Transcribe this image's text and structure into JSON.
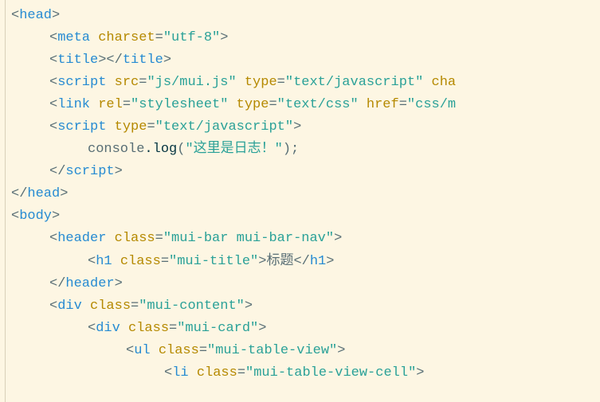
{
  "lines": [
    {
      "indent": 1,
      "segments": [
        {
          "cls": "punct",
          "t": "<"
        },
        {
          "cls": "tag",
          "t": "head"
        },
        {
          "cls": "punct",
          "t": ">"
        }
      ]
    },
    {
      "indent": 2,
      "segments": [
        {
          "cls": "punct",
          "t": "<"
        },
        {
          "cls": "tag",
          "t": "meta "
        },
        {
          "cls": "attr",
          "t": "charset"
        },
        {
          "cls": "equals",
          "t": "="
        },
        {
          "cls": "string",
          "t": "\"utf-8\""
        },
        {
          "cls": "punct",
          "t": ">"
        }
      ]
    },
    {
      "indent": 2,
      "segments": [
        {
          "cls": "punct",
          "t": "<"
        },
        {
          "cls": "tag",
          "t": "title"
        },
        {
          "cls": "punct",
          "t": "></"
        },
        {
          "cls": "tag",
          "t": "title"
        },
        {
          "cls": "punct",
          "t": ">"
        }
      ]
    },
    {
      "indent": 2,
      "segments": [
        {
          "cls": "punct",
          "t": "<"
        },
        {
          "cls": "tag",
          "t": "script "
        },
        {
          "cls": "attr",
          "t": "src"
        },
        {
          "cls": "equals",
          "t": "="
        },
        {
          "cls": "string",
          "t": "\"js/mui.js\""
        },
        {
          "cls": "tag",
          "t": " "
        },
        {
          "cls": "attr",
          "t": "type"
        },
        {
          "cls": "equals",
          "t": "="
        },
        {
          "cls": "string",
          "t": "\"text/javascript\""
        },
        {
          "cls": "tag",
          "t": " "
        },
        {
          "cls": "attr",
          "t": "cha"
        }
      ]
    },
    {
      "indent": 2,
      "segments": [
        {
          "cls": "punct",
          "t": "<"
        },
        {
          "cls": "tag",
          "t": "link "
        },
        {
          "cls": "attr",
          "t": "rel"
        },
        {
          "cls": "equals",
          "t": "="
        },
        {
          "cls": "string",
          "t": "\"stylesheet\""
        },
        {
          "cls": "tag",
          "t": " "
        },
        {
          "cls": "attr",
          "t": "type"
        },
        {
          "cls": "equals",
          "t": "="
        },
        {
          "cls": "string",
          "t": "\"text/css\""
        },
        {
          "cls": "tag",
          "t": " "
        },
        {
          "cls": "attr",
          "t": "href"
        },
        {
          "cls": "equals",
          "t": "="
        },
        {
          "cls": "string",
          "t": "\"css/m"
        }
      ]
    },
    {
      "indent": 2,
      "segments": [
        {
          "cls": "punct",
          "t": "<"
        },
        {
          "cls": "tag",
          "t": "script "
        },
        {
          "cls": "attr",
          "t": "type"
        },
        {
          "cls": "equals",
          "t": "="
        },
        {
          "cls": "string",
          "t": "\"text/javascript\""
        },
        {
          "cls": "punct",
          "t": ">"
        }
      ]
    },
    {
      "indent": 3,
      "segments": [
        {
          "cls": "method",
          "t": "console"
        },
        {
          "cls": "dark",
          "t": "."
        },
        {
          "cls": "dark",
          "t": "log"
        },
        {
          "cls": "method",
          "t": "("
        },
        {
          "cls": "stringgreen",
          "t": "\"这里是日志！\""
        },
        {
          "cls": "method",
          "t": ");"
        }
      ]
    },
    {
      "indent": 2,
      "segments": [
        {
          "cls": "punct",
          "t": "</"
        },
        {
          "cls": "tag",
          "t": "script"
        },
        {
          "cls": "punct",
          "t": ">"
        }
      ]
    },
    {
      "indent": 1,
      "segments": [
        {
          "cls": "punct",
          "t": "</"
        },
        {
          "cls": "tag",
          "t": "head"
        },
        {
          "cls": "punct",
          "t": ">"
        }
      ]
    },
    {
      "indent": 1,
      "segments": [
        {
          "cls": "punct",
          "t": "<"
        },
        {
          "cls": "tag",
          "t": "body"
        },
        {
          "cls": "punct",
          "t": ">"
        }
      ]
    },
    {
      "indent": 2,
      "segments": [
        {
          "cls": "punct",
          "t": "<"
        },
        {
          "cls": "tag",
          "t": "header "
        },
        {
          "cls": "attr",
          "t": "class"
        },
        {
          "cls": "equals",
          "t": "="
        },
        {
          "cls": "string",
          "t": "\"mui-bar mui-bar-nav\""
        },
        {
          "cls": "punct",
          "t": ">"
        }
      ]
    },
    {
      "indent": 3,
      "segments": [
        {
          "cls": "punct",
          "t": "<"
        },
        {
          "cls": "tag",
          "t": "h1 "
        },
        {
          "cls": "attr",
          "t": "class"
        },
        {
          "cls": "equals",
          "t": "="
        },
        {
          "cls": "string",
          "t": "\"mui-title\""
        },
        {
          "cls": "punct",
          "t": ">"
        },
        {
          "cls": "text",
          "t": "标题"
        },
        {
          "cls": "punct",
          "t": "</"
        },
        {
          "cls": "tag",
          "t": "h1"
        },
        {
          "cls": "punct",
          "t": ">"
        }
      ]
    },
    {
      "indent": 2,
      "segments": [
        {
          "cls": "punct",
          "t": "</"
        },
        {
          "cls": "tag",
          "t": "header"
        },
        {
          "cls": "punct",
          "t": ">"
        }
      ]
    },
    {
      "indent": 2,
      "segments": [
        {
          "cls": "punct",
          "t": "<"
        },
        {
          "cls": "tag",
          "t": "div "
        },
        {
          "cls": "attr",
          "t": "class"
        },
        {
          "cls": "equals",
          "t": "="
        },
        {
          "cls": "string",
          "t": "\"mui-content\""
        },
        {
          "cls": "punct",
          "t": ">"
        }
      ]
    },
    {
      "indent": 3,
      "segments": [
        {
          "cls": "punct",
          "t": "<"
        },
        {
          "cls": "tag",
          "t": "div "
        },
        {
          "cls": "attr",
          "t": "class"
        },
        {
          "cls": "equals",
          "t": "="
        },
        {
          "cls": "string",
          "t": "\"mui-card\""
        },
        {
          "cls": "punct",
          "t": ">"
        }
      ]
    },
    {
      "indent": 4,
      "segments": [
        {
          "cls": "punct",
          "t": "<"
        },
        {
          "cls": "tag",
          "t": "ul "
        },
        {
          "cls": "attr",
          "t": "class"
        },
        {
          "cls": "equals",
          "t": "="
        },
        {
          "cls": "string",
          "t": "\"mui-table-view\""
        },
        {
          "cls": "punct",
          "t": ">"
        }
      ]
    },
    {
      "indent": 5,
      "segments": [
        {
          "cls": "punct",
          "t": "<"
        },
        {
          "cls": "tag",
          "t": "li "
        },
        {
          "cls": "attr",
          "t": "class"
        },
        {
          "cls": "equals",
          "t": "="
        },
        {
          "cls": "string",
          "t": "\"mui-table-view-cell\""
        },
        {
          "cls": "punct",
          "t": ">"
        }
      ]
    }
  ]
}
